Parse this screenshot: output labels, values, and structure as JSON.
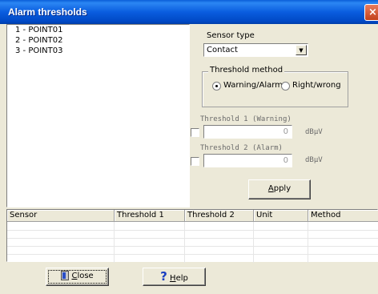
{
  "window": {
    "title": "Alarm thresholds",
    "close_glyph": "×"
  },
  "points": [
    {
      "label": "1 - POINT01"
    },
    {
      "label": "2 - POINT02"
    },
    {
      "label": "3 - POINT03"
    }
  ],
  "sensor_type": {
    "label": "Sensor type",
    "value": "Contact",
    "dropdown_glyph": "▼"
  },
  "threshold_method": {
    "legend": "Threshold method",
    "options": [
      {
        "label": "Warning/Alarm",
        "selected": true
      },
      {
        "label": "Right/wrong",
        "selected": false
      }
    ]
  },
  "threshold1": {
    "label": "Threshold 1 (Warning)",
    "value": "0",
    "unit": "dBµV",
    "checked": false
  },
  "threshold2": {
    "label": "Threshold 2 (Alarm)",
    "value": "0",
    "unit": "dBµV",
    "checked": false
  },
  "apply_button": {
    "label_underlined": "A",
    "label_rest": "pply"
  },
  "table": {
    "columns": [
      "Sensor",
      "Threshold 1",
      "Threshold 2",
      "Unit",
      "Method"
    ],
    "rows": []
  },
  "close_button": {
    "label_underlined": "C",
    "label_rest": "lose",
    "icon": "door-icon"
  },
  "help_button": {
    "glyph": "?",
    "label_underlined": "H",
    "label_rest": "elp",
    "icon": "help-icon"
  }
}
